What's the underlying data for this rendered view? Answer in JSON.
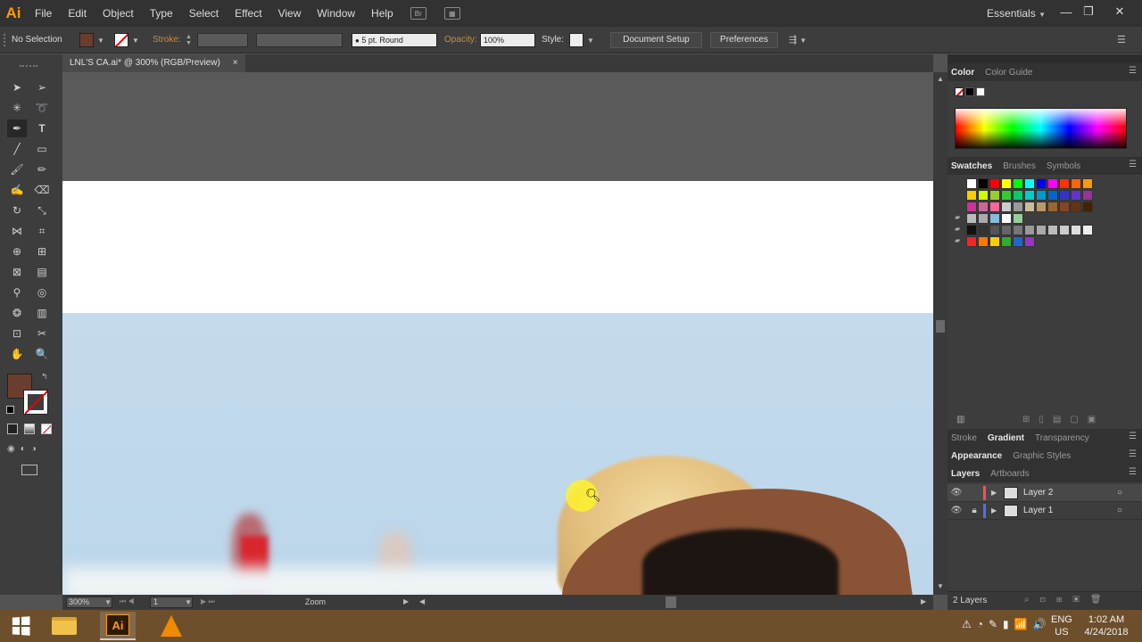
{
  "app": {
    "logo": "Ai",
    "accent": "#ff9a00"
  },
  "menu": [
    "File",
    "Edit",
    "Object",
    "Type",
    "Select",
    "Effect",
    "View",
    "Window",
    "Help"
  ],
  "menu_icons": [
    "Br"
  ],
  "workspace": "Essentials",
  "control": {
    "selection": "No Selection",
    "stroke_label": "Stroke:",
    "brush": "5 pt. Round",
    "opacity_label": "Opacity:",
    "opacity_value": "100%",
    "style_label": "Style:",
    "document_setup": "Document Setup",
    "preferences": "Preferences",
    "fill_color": "#6b3d2e"
  },
  "document": {
    "tab_title": "LNL'S CA.ai* @ 300% (RGB/Preview)",
    "close": "×"
  },
  "status": {
    "zoom": "300%",
    "artboard": "1",
    "tool_name": "Zoom"
  },
  "panels": {
    "color_tabs": [
      "Color",
      "Color Guide"
    ],
    "swatch_tabs": [
      "Swatches",
      "Brushes",
      "Symbols"
    ],
    "stroke_tabs": [
      "Stroke",
      "Gradient",
      "Transparency"
    ],
    "appearance_tabs": [
      "Appearance",
      "Graphic Styles"
    ],
    "layer_tabs": [
      "Layers",
      "Artboards"
    ],
    "layers": [
      {
        "name": "Layer 2",
        "color": "#ff4d4d"
      },
      {
        "name": "Layer 1",
        "color": "#4d6dff"
      }
    ],
    "layers_count": "2 Layers"
  },
  "swatch_rows": [
    [
      "#ffffff",
      "#000000",
      "#ff0000",
      "#ffff00",
      "#00ff00",
      "#00ffff",
      "#0000ff",
      "#ff00ff",
      "#ff3300",
      "#ff6600",
      "#ff9900"
    ],
    [
      "#ffcc00",
      "#ccff00",
      "#99cc33",
      "#33cc33",
      "#00cc66",
      "#00cccc",
      "#0099cc",
      "#0066cc",
      "#3333cc",
      "#6633cc",
      "#993399"
    ],
    [
      "#cc3399",
      "#cc6699",
      "#ff6699",
      "#cccccc",
      "#999999",
      "#ccbb99",
      "#bb9966",
      "#996633",
      "#884422",
      "#663311",
      "#442200"
    ],
    [
      "#bbbbbb",
      "#aaaaaa",
      "#88bbdd",
      "#ffffff",
      "#99cc99"
    ],
    [
      "#111111",
      "#333333",
      "#555555",
      "#666666",
      "#777777",
      "#999999",
      "#aaaaaa",
      "#bbbbbb",
      "#cccccc",
      "#dddddd",
      "#eeeeee"
    ],
    [
      "#ff2222",
      "#ff7700",
      "#ffcc00",
      "#33aa33",
      "#2266cc",
      "#9933cc"
    ]
  ],
  "taskbar": {
    "lang1": "ENG",
    "lang2": "US",
    "time": "1:02 AM",
    "date": "4/24/2018"
  }
}
